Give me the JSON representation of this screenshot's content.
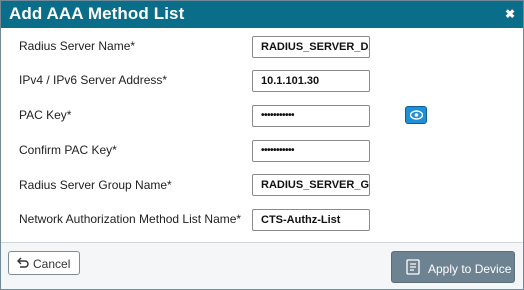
{
  "dialog": {
    "title": "Add AAA Method List",
    "close_glyph": "✖"
  },
  "form": {
    "fields": [
      {
        "label": "Radius Server Name*",
        "value": "RADIUS_SERVER_DAYO",
        "type": "text"
      },
      {
        "label": "IPv4 / IPv6 Server Address*",
        "value": "10.1.101.30",
        "type": "text"
      },
      {
        "label": "PAC Key*",
        "value": "•••••••••••",
        "type": "password"
      },
      {
        "label": "Confirm PAC Key*",
        "value": "•••••••••••",
        "type": "password"
      },
      {
        "label": "Radius Server Group Name*",
        "value": "RADIUS_SERVER_GROU",
        "type": "text"
      },
      {
        "label": "Network Authorization Method List Name*",
        "value": "CTS-Authz-List",
        "type": "text"
      }
    ],
    "show_key_icon": "eye-icon"
  },
  "footer": {
    "cancel_label": "Cancel",
    "cancel_icon": "undo-icon",
    "apply_label": "Apply to Device",
    "apply_icon": "document-icon"
  },
  "colors": {
    "title_bar": "#0a6e8a",
    "apply_button": "#6e8391",
    "eye_button": "#1f8fd6"
  }
}
